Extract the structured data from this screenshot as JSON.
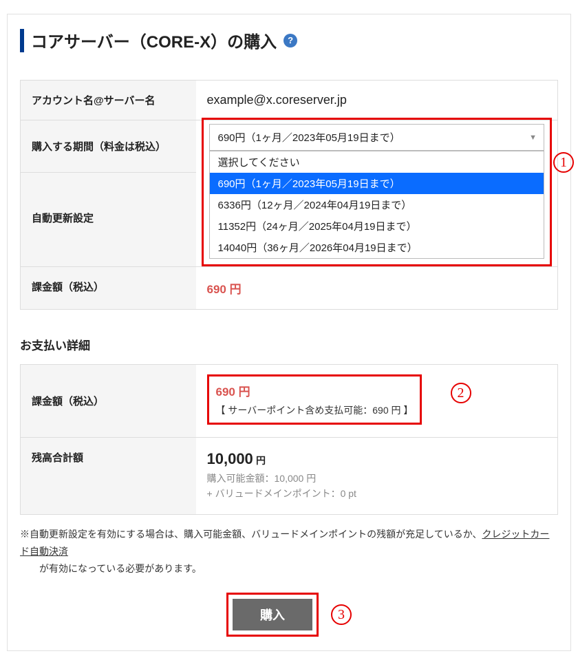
{
  "title": "コアサーバー（CORE-X）の購入",
  "table1": {
    "account_label": "アカウント名@サーバー名",
    "account_value": "example@x.coreserver.jp",
    "period_label": "購入する期間（料金は税込）",
    "auto_label": "自動更新設定",
    "bill_label": "課金額（税込）",
    "bill_value": "690 円"
  },
  "dropdown": {
    "selected": "690円（1ヶ月／2023年05月19日まで）",
    "placeholder": "選択してください",
    "opt1": "690円（1ヶ月／2023年05月19日まで）",
    "opt2": "6336円（12ヶ月／2024年04月19日まで）",
    "opt3": "11352円（24ヶ月／2025年04月19日まで）",
    "opt4": "14040円（36ヶ月／2026年04月19日まで）"
  },
  "payment_header": "お支払い詳細",
  "table2": {
    "bill_label": "課金額（税込）",
    "bill_value": "690 円",
    "sp_note": "【 サーバーポイント含め支払可能：690 円 】",
    "balance_label": "残高合計額",
    "balance_value": "10,000",
    "balance_unit": "円",
    "balance_sub1": "購入可能金額：10,000 円",
    "balance_sub2": "+ バリュードメインポイント：0 pt"
  },
  "note_prefix": "※自動更新設定を有効にする場合は、購入可能金額、バリュードメインポイントの残額が充足しているか、",
  "note_link": "クレジットカード自動決済",
  "note_suffix": "が有効になっている必要があります。",
  "submit_label": "購入",
  "annots": {
    "a1": "1",
    "a2": "2",
    "a3": "3"
  }
}
